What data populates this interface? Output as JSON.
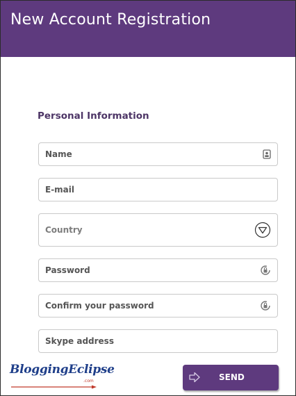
{
  "header": {
    "title": "New Account Registration"
  },
  "section": {
    "title": "Personal Information"
  },
  "form": {
    "name": {
      "placeholder": "Name",
      "icon": "contact-card-icon"
    },
    "email": {
      "placeholder": "E-mail"
    },
    "country": {
      "placeholder": "Country",
      "icon": "dropdown-arrow-icon"
    },
    "password": {
      "placeholder": "Password",
      "icon": "lock-icon"
    },
    "confirm_password": {
      "placeholder": "Confirm your password",
      "icon": "lock-icon"
    },
    "skype": {
      "placeholder": "Skype address"
    }
  },
  "logo": {
    "text": "BloggingEclipse",
    "suffix": ".com"
  },
  "send_button": {
    "label": "SEND",
    "icon": "send-arrow-icon"
  },
  "colors": {
    "accent": "#5e3a7e",
    "section_title": "#4d3566",
    "field_border": "#c9c9c9"
  }
}
